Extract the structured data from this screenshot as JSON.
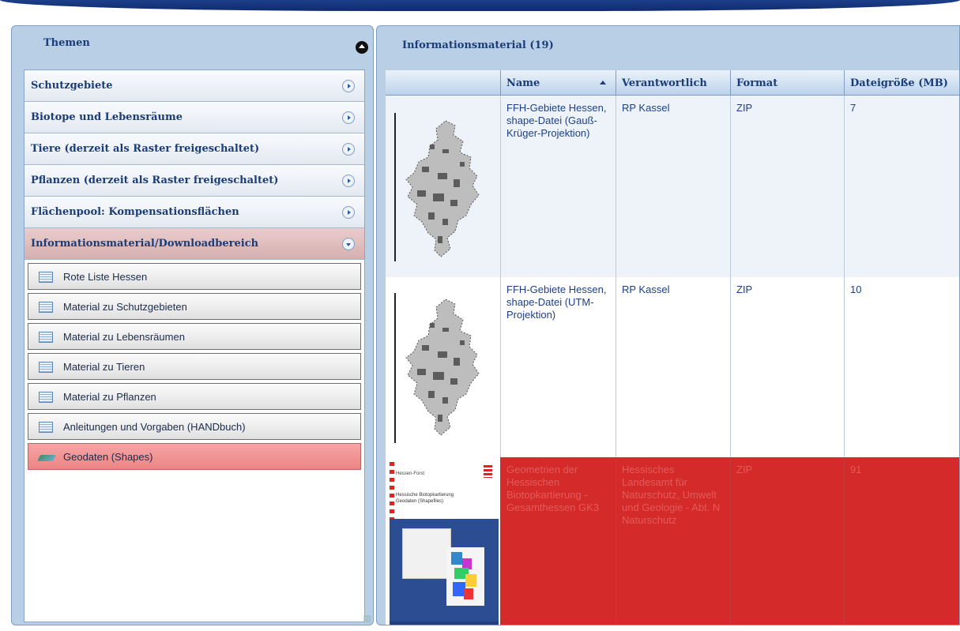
{
  "left_panel": {
    "title": "Themen",
    "categories": [
      {
        "label": "Schutzgebiete"
      },
      {
        "label": "Biotope und Lebensräume"
      },
      {
        "label": "Tiere (derzeit als Raster freigeschaltet)"
      },
      {
        "label": "Pflanzen (derzeit als Raster freigeschaltet)"
      },
      {
        "label": "Flächenpool: Kompensationsflächen"
      },
      {
        "label": "Informationsmaterial/Downloadbereich"
      }
    ],
    "subitems": [
      {
        "label": "Rote Liste Hessen"
      },
      {
        "label": "Material zu Schutzgebieten"
      },
      {
        "label": "Material zu Lebensräumen"
      },
      {
        "label": "Material zu Tieren"
      },
      {
        "label": "Material zu Pflanzen"
      },
      {
        "label": "Anleitungen und Vorgaben (HANDbuch)"
      },
      {
        "label": "Geodaten (Shapes)"
      }
    ]
  },
  "right_panel": {
    "title": "Informationsmaterial (19)",
    "columns": {
      "name": "Name",
      "responsible": "Verantwortlich",
      "format": "Format",
      "size": "Dateigröße (MB)"
    },
    "rows": [
      {
        "name": "FFH-Gebiete Hessen, shape-Datei (Gauß-Krüger-Projektion)",
        "responsible": "RP Kassel",
        "format": "ZIP",
        "size": "7"
      },
      {
        "name": "FFH-Gebiete Hessen, shape-Datei (UTM-Projektion)",
        "responsible": "RP Kassel",
        "format": "ZIP",
        "size": "10"
      },
      {
        "name": "Geometrien der Hessischen Biotopkartierung - Gesamthessen GK3",
        "responsible": "Hessisches Landesamt für Naturschutz, Umwelt und Geologie - Abt. N Naturschutz",
        "format": "ZIP",
        "size": "91"
      }
    ],
    "cover": {
      "header": "Hessen-Forst",
      "title_line1": "Hessische Biotopkartierung",
      "title_line2": "Geodaten (Shapefiles)"
    }
  },
  "colors": {
    "accent_blue": "#1a3d7a",
    "selected_row": "#d42a2a",
    "panel_bg": "#b9cfe6"
  }
}
